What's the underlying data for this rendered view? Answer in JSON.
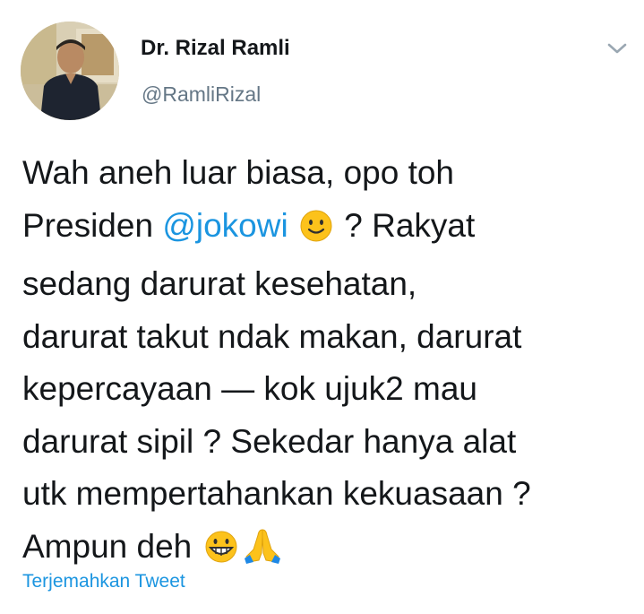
{
  "tweet": {
    "display_name": "Dr. Rizal Ramli",
    "handle": "@RamliRizal",
    "lines": {
      "l1": "Wah aneh luar biasa, opo toh",
      "l2a": "Presiden ",
      "l2_mention": "@jokowi",
      "l2b": "? Rakyat",
      "l3": "sedang darurat kesehatan,",
      "l4": "darurat takut ndak makan, darurat",
      "l5": "kepercayaan — kok ujuk2 mau",
      "l6": "darurat sipil ? Sekedar hanya alat",
      "l7": "utk mempertahankan kekuasaan ?",
      "l8": "Ampun deh"
    },
    "translate_label": "Terjemahkan Tweet"
  },
  "icons": {
    "avatar": "profile-photo",
    "caret": "chevron-down-icon",
    "emoji_1": "slightly-smiling-face-emoji",
    "emoji_2": "grinning-face-emoji",
    "emoji_3": "folded-hands-emoji"
  },
  "colors": {
    "link": "#1b95e0",
    "secondary_text": "#657786",
    "primary_text": "#14171a"
  }
}
